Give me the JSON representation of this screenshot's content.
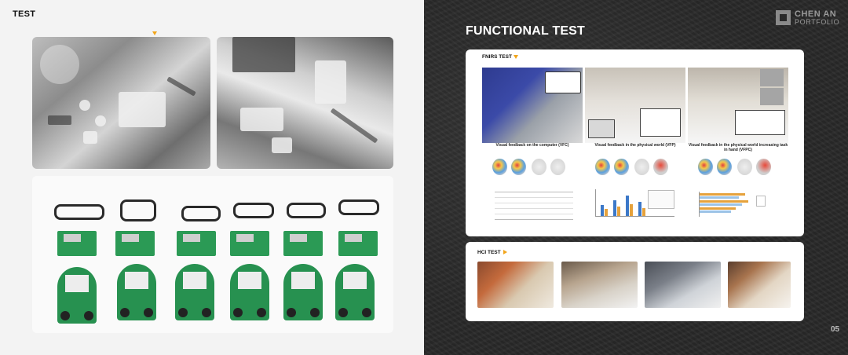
{
  "left_title": "TEST",
  "right_title": "FUNCTIONAL TEST",
  "logo": {
    "line1": "CHEN AN",
    "line2": "PORTFOLIO"
  },
  "fnirs": {
    "label": "FNIRS TEST",
    "captions": [
      "Visual feedback on the computer (VFC)",
      "Visual feedback in the physical world (VFP)",
      "Visual feedback in the physical world increasing task in hand (VFPC)"
    ]
  },
  "hci": {
    "label": "HCI TEST"
  },
  "page_number": "05",
  "colors": {
    "accent": "#f2a51a",
    "robot_green": "#279150",
    "chart_blue": "#3c78c8"
  }
}
